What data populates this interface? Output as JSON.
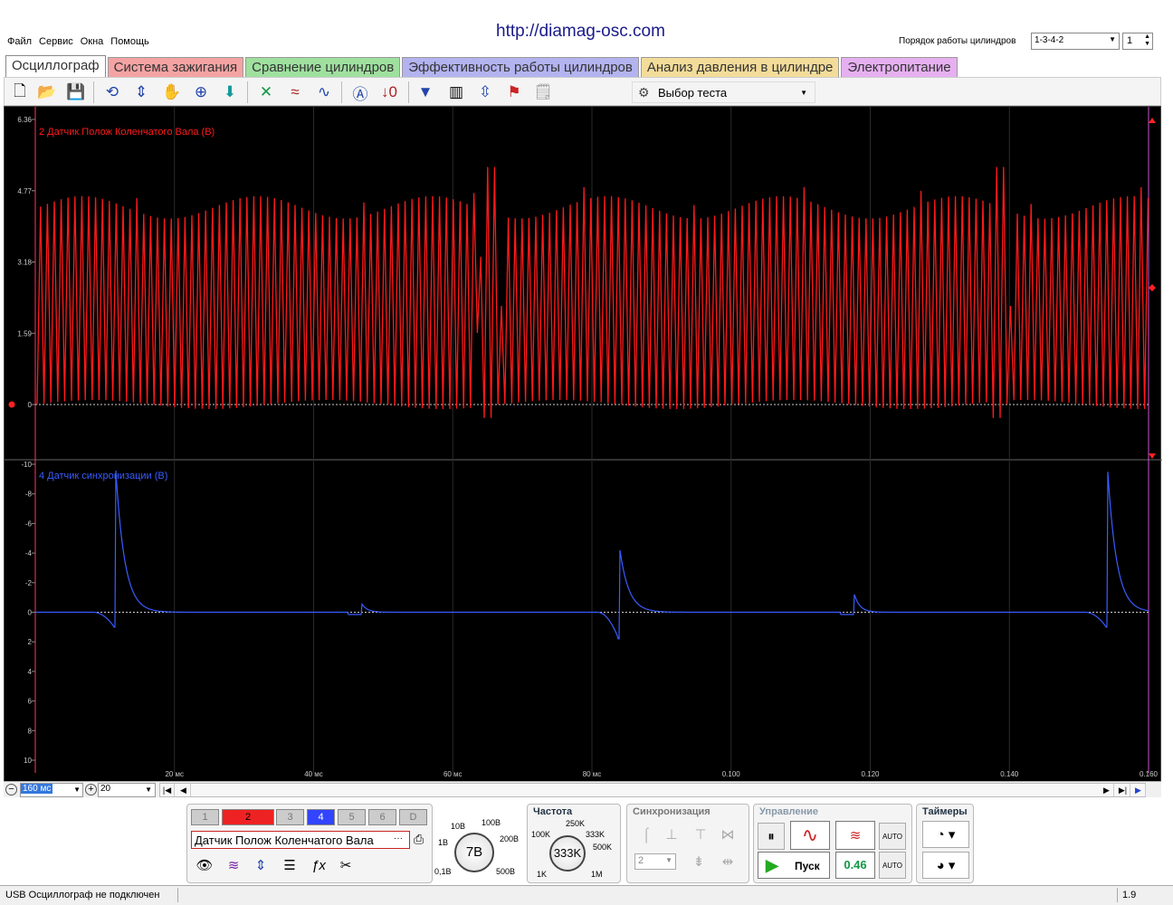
{
  "watermark": "http://diamag-osc.com",
  "menu": [
    "Файл",
    "Сервис",
    "Окна",
    "Помощь"
  ],
  "cylinder_order": {
    "label": "Порядок работы цилиндров",
    "value": "1-3-4-2",
    "spin_value": "1"
  },
  "tabs": [
    {
      "label": "Осциллограф",
      "color": "#ffffff"
    },
    {
      "label": "Система зажигания",
      "color": "#f4a3a3"
    },
    {
      "label": "Сравнение цилиндров",
      "color": "#9fe09f"
    },
    {
      "label": "Эффективность работы цилиндров",
      "color": "#b3b3f0"
    },
    {
      "label": "Анализ давления в цилиндре",
      "color": "#f3dc9a"
    },
    {
      "label": "Электропитание",
      "color": "#e6b0f0"
    }
  ],
  "toolbar": {
    "test_select": "Выбор теста",
    "icons": [
      "new-file-icon",
      "open-folder-icon",
      "save-icon",
      "rotate-icon",
      "scale-icon",
      "hand-icon",
      "zoom-icon",
      "cursor-icon",
      "wave1-icon",
      "wave2-icon",
      "wave3-icon",
      "auto-icon",
      "zero-icon",
      "filter-icon",
      "table-icon",
      "split-icon",
      "marker-icon",
      "notes-icon"
    ]
  },
  "channel1": {
    "title": "2 Датчик Полож Коленчатого Вала (В)",
    "color": "#ff1a1a",
    "y_ticks": [
      "6.36",
      "4.77",
      "3.18",
      "1.59",
      "0"
    ]
  },
  "channel2": {
    "title": "4 Датчик синхронизации (В)",
    "color": "#3a5cff",
    "y_ticks": [
      "-10",
      "-8",
      "-6",
      "-4",
      "-2",
      "0",
      "2",
      "4",
      "6",
      "8",
      "10"
    ]
  },
  "x_ticks": [
    "20 мс",
    "40 мс",
    "60 мс",
    "80 мс",
    "0.100",
    "0.120",
    "0.140",
    "0.160"
  ],
  "timebase": {
    "div": "160 мс",
    "points": "20"
  },
  "channels_buttons": [
    "1",
    "2",
    "3",
    "4",
    "5",
    "6",
    "D"
  ],
  "channel_select": "Датчик Полож Коленчатого Вала",
  "voltage": {
    "value": "7В",
    "labels": [
      "10В",
      "100В",
      "1В",
      "200В",
      "0,1В",
      "500В"
    ]
  },
  "frequency": {
    "title": "Частота",
    "value": "333K",
    "labels": [
      "250K",
      "100K",
      "333K",
      "500K",
      "1K",
      "1M"
    ]
  },
  "sync": {
    "title": "Синхронизация",
    "value": "2"
  },
  "control": {
    "title": "Управление",
    "start": "Пуск",
    "value": "0.46"
  },
  "timers": {
    "title": "Таймеры"
  },
  "status": {
    "text": "USB Осциллограф не подключен",
    "version": "1.9"
  }
}
